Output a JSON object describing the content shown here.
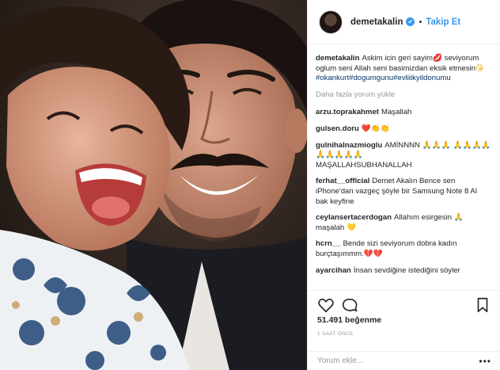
{
  "post": {
    "username": "demetakalin",
    "verified_mark": "✔",
    "separator": "•",
    "follow_label": "Takip Et",
    "caption": {
      "username": "demetakalin",
      "text": "Askim icin geri sayim",
      "emoji1": "💋",
      "text2": " seviyorum oglum seni Allah seni basimizdan eksik etmesin",
      "emoji2": "😘",
      "hashtags": "#okankurt#dogumgunu#evliiikyildonumu"
    },
    "load_more": "Daha fazla yorum yükle",
    "comments": [
      {
        "user": "arzu.toprakahmet",
        "text": "Maşallah",
        "emoji": ""
      },
      {
        "user": "gulsen.doru",
        "text": "",
        "emoji": "❤️👏👏"
      },
      {
        "user": "gulnihalnazmioglu",
        "text": "AMİNNNN",
        "emoji": "🙏🙏🙏 🙏🙏🙏🙏🙏🙏🙏🙏🙏",
        "text2": "MAŞALLAHSUBHANALLAH"
      },
      {
        "user": "ferhat__official",
        "text": "Demet Akalın Bence sen iPhone'dan vazgeç şöyle bir Samsung Note 8 Al bak keyfine",
        "emoji": ""
      },
      {
        "user": "ceylansertacerdogan",
        "text": "Allahım esirgesin",
        "emoji": "🙏",
        "text2": "maşalah",
        "emoji2": "💛"
      },
      {
        "user": "hcrn__",
        "text": "Bende sizi seviyorum dobra kadın burçtaşımmm.",
        "emoji": "💔💔"
      },
      {
        "user": "ayarcihan",
        "text": "İnsan sevdiğine istediğini söyler",
        "emoji": ""
      }
    ],
    "likes": "51.491 beğenme",
    "time_ago": "1 SAAT ÖNCE",
    "add_comment_placeholder": "Yorum ekle...",
    "more_options": "•••",
    "icons": [
      "heart-icon",
      "comment-icon",
      "bookmark-icon",
      "more-options-icon"
    ]
  }
}
